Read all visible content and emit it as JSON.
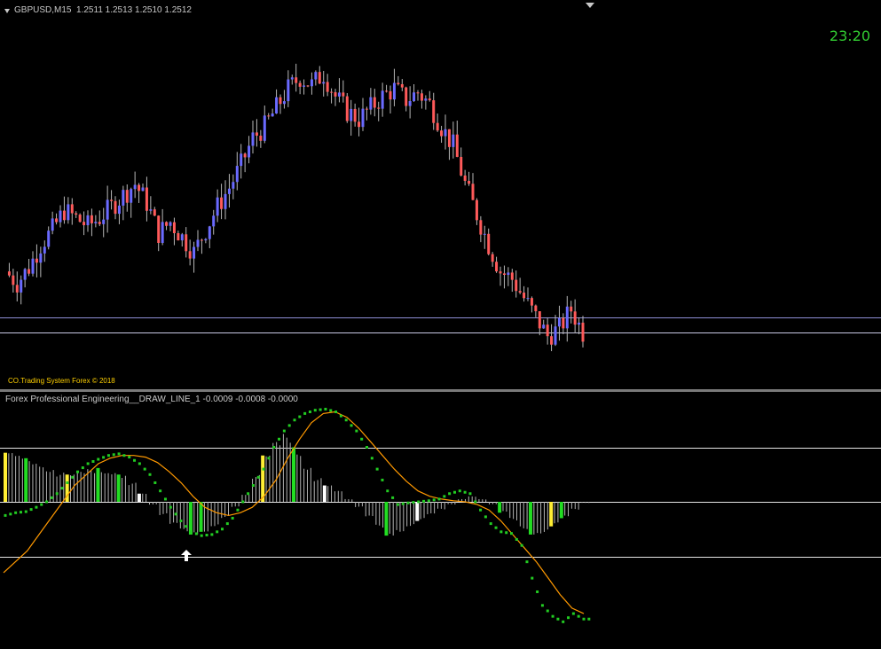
{
  "header": {
    "symbol": "GBPUSD,M15",
    "ohlc": "1.2511 1.2513 1.2510 1.2512"
  },
  "clock": "23:20",
  "copyright": "CO.Trading System Forex © 2018",
  "indicator": {
    "title": "Forex Professional Engineering__DRAW_LINE_1 -0.0009 -0.0008 -0.0000"
  },
  "colors": {
    "background": "#000000",
    "bull_candle": "#6a6aff",
    "bear_candle": "#ff5a5a",
    "wick": "#b8b8b8",
    "horizontal_line": "#c8c8e6",
    "histogram_gray": "#b4b4b4",
    "histogram_green": "#22dd22",
    "histogram_yellow": "#ffee33",
    "histogram_white": "#ffffff",
    "dots": "#22cc22",
    "smooth_line": "#ff9900",
    "clock": "#32cd32",
    "copyright": "#ffd000"
  },
  "chart_data": [
    {
      "type": "line",
      "series": [
        {
          "name": "GBPUSD,M15",
          "values": [
            1.2498,
            1.2495,
            1.2499,
            1.2505,
            1.2509,
            1.2514,
            1.2512,
            1.251,
            1.2512,
            1.2515,
            1.2518,
            1.2521,
            1.2516,
            1.2508,
            1.2511,
            1.2507,
            1.2503,
            1.2509,
            1.2515,
            1.252,
            1.2526,
            1.2533,
            1.2536,
            1.2541,
            1.2546,
            1.2549,
            1.2547,
            1.255,
            1.2544,
            1.254,
            1.2538,
            1.2541,
            1.2544,
            1.2546,
            1.2543,
            1.2545,
            1.2542,
            1.2536,
            1.2531,
            1.2521,
            1.2513,
            1.2505,
            1.2498,
            1.2496,
            1.2491,
            1.2486,
            1.2481,
            1.2483,
            1.2488,
            1.2482
          ]
        }
      ],
      "lines": [
        1.2486,
        1.2482
      ]
    },
    {
      "type": "bar",
      "title": "Forex Professional Engineering__DRAW_LINE_1 -0.0009 -0.0008 -0.0000",
      "levels": [
        1,
        0,
        -1
      ],
      "values": [
        0.9,
        0.85,
        0.8,
        0.75,
        0.65,
        0.55,
        0.5,
        0.55,
        0.6,
        0.62,
        0.6,
        0.5,
        0.35,
        0.15,
        -0.05,
        -0.25,
        -0.45,
        -0.58,
        -0.6,
        -0.55,
        -0.45,
        -0.3,
        -0.1,
        0.15,
        0.5,
        0.85,
        1.1,
        1.25,
        1.0,
        0.7,
        0.45,
        0.3,
        0.2,
        0.05,
        -0.1,
        -0.3,
        -0.5,
        -0.62,
        -0.55,
        -0.45,
        -0.35,
        -0.25,
        -0.15,
        -0.05,
        0.05,
        0.1,
        0.05,
        -0.05,
        -0.2,
        -0.35,
        -0.5,
        -0.6,
        -0.58,
        -0.45,
        -0.3,
        -0.15,
        -0.02
      ],
      "dots": [
        -0.25,
        -0.2,
        -0.18,
        -0.1,
        0.0,
        0.15,
        0.35,
        0.55,
        0.7,
        0.78,
        0.85,
        0.88,
        0.82,
        0.7,
        0.5,
        0.2,
        -0.1,
        -0.35,
        -0.55,
        -0.62,
        -0.6,
        -0.5,
        -0.3,
        0.0,
        0.3,
        0.6,
        1.0,
        1.3,
        1.5,
        1.62,
        1.68,
        1.7,
        1.65,
        1.5,
        1.3,
        1.0,
        0.6,
        0.2,
        -0.05,
        -0.02,
        0.0,
        0.02,
        0.05,
        0.15,
        0.2,
        0.15,
        -0.15,
        -0.4,
        -0.55,
        -0.58,
        -0.8,
        -1.4,
        -1.9,
        -2.1,
        -2.2,
        -2.05,
        -2.15
      ],
      "smooth": [
        -1.3,
        -1.1,
        -0.9,
        -0.6,
        -0.3,
        0.0,
        0.3,
        0.5,
        0.7,
        0.8,
        0.85,
        0.85,
        0.82,
        0.72,
        0.55,
        0.35,
        0.1,
        -0.1,
        -0.2,
        -0.25,
        -0.2,
        -0.1,
        0.1,
        0.4,
        0.8,
        1.15,
        1.45,
        1.62,
        1.65,
        1.55,
        1.35,
        1.1,
        0.85,
        0.6,
        0.38,
        0.2,
        0.1,
        0.05,
        0.02,
        0.0,
        -0.05,
        -0.15,
        -0.35,
        -0.6,
        -0.85,
        -1.1,
        -1.4,
        -1.7,
        -1.95,
        -2.05
      ]
    }
  ]
}
